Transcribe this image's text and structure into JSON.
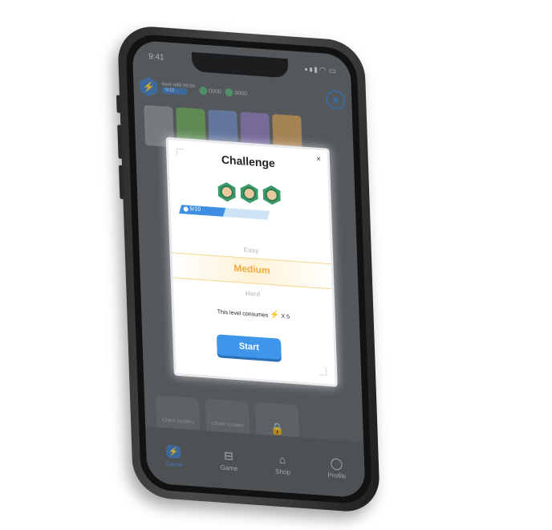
{
  "status": {
    "time": "9:41"
  },
  "header": {
    "energy_text": "Next refill 59:59",
    "energy_pill": "5/10",
    "coin1": "0000",
    "coin2": "0000"
  },
  "cards": {
    "colors": [
      "#8b8e92",
      "#6aa35a",
      "#6f87b8",
      "#8a78b6",
      "#c89a5a"
    ]
  },
  "grid": {
    "cells": [
      "Check location",
      "Check location",
      ""
    ]
  },
  "modal": {
    "title": "Challenge",
    "close": "×",
    "progress_label": "5/10",
    "progress_value": 0.5,
    "difficulty": {
      "easy": "Easy",
      "medium": "Medium",
      "hard": "Hard"
    },
    "consume_text": "This level consumes",
    "consume_amount": "X 5",
    "start": "Start"
  },
  "tabbar": {
    "tabs": [
      {
        "label": "Game",
        "icon": "lightning-icon",
        "active": true
      },
      {
        "label": "Game",
        "icon": "briefcase-icon",
        "active": false
      },
      {
        "label": "Shop",
        "icon": "shop-icon",
        "active": false
      },
      {
        "label": "Profile",
        "icon": "profile-icon",
        "active": false
      }
    ]
  },
  "colors": {
    "accent": "#3e95ea",
    "medium": "#f0a93b"
  }
}
